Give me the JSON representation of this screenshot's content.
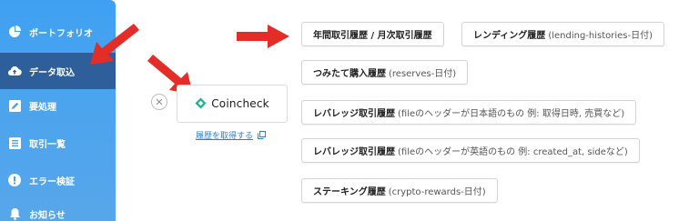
{
  "sidebar": {
    "items": [
      {
        "label": "ポートフォリオ",
        "icon": "pie-chart-icon"
      },
      {
        "label": "データ取込",
        "icon": "cloud-upload-icon",
        "active": true
      },
      {
        "label": "要処理",
        "icon": "edit-icon"
      },
      {
        "label": "取引一覧",
        "icon": "list-icon"
      },
      {
        "label": "エラー検証",
        "icon": "alert-icon"
      },
      {
        "label": "お知らせ",
        "icon": "bell-icon"
      }
    ]
  },
  "exchange": {
    "name": "Coincheck",
    "fetch_history_label": "履歴を取得する"
  },
  "buttons": {
    "trade_history": "年間取引履歴 / 月次取引履歴",
    "lending_history": {
      "main": "レンディング履歴",
      "sub": "(lending-histories-日付)"
    },
    "reserves_history": {
      "main": "つみたて購入履歴",
      "sub": "(reserves-日付)"
    },
    "leverage_jp": {
      "main": "レバレッジ取引履歴",
      "sub": "(fileのヘッダーが日本語のもの 例: 取得日時, 売買など)"
    },
    "leverage_en": {
      "main": "レバレッジ取引履歴",
      "sub": "(fileのヘッダーが英語のもの 例: created_at, sideなど)"
    },
    "staking_history": {
      "main": "ステーキング履歴",
      "sub": "(crypto-rewards-日付)"
    }
  },
  "colors": {
    "sidebar_top": "#3fa0f2",
    "sidebar_active": "#2f5f9a",
    "arrow": "#e52d27",
    "link": "#2f7fd0",
    "coincheck_green": "#19b38a"
  }
}
